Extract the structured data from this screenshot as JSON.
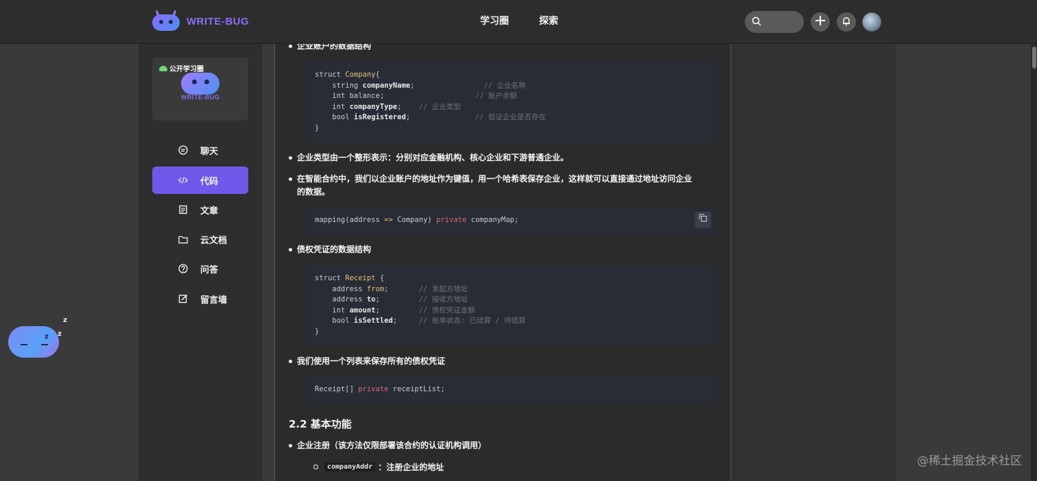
{
  "header": {
    "logo_text": "WRITE-BUG",
    "nav": [
      "学习圈",
      "探索"
    ],
    "search_placeholder": ""
  },
  "sidebar": {
    "circle_tag": "公开学习圈",
    "circle_brand": "WRITE-BUG",
    "items": [
      {
        "label": "聊天",
        "icon": "chat-icon"
      },
      {
        "label": "代码",
        "icon": "code-icon",
        "active": true
      },
      {
        "label": "文章",
        "icon": "article-icon"
      },
      {
        "label": "云文档",
        "icon": "folder-icon"
      },
      {
        "label": "问答",
        "icon": "question-icon"
      },
      {
        "label": "留言墙",
        "icon": "edit-icon"
      }
    ]
  },
  "content": {
    "b1": "企业账户的数据结构",
    "b2": "企业类型由一个整形表示：分别对应金融机构、核心企业和下游普通企业。",
    "b3_line1": "在智能合约中，我们以企业账户的地址作为键值，用一个哈希表保存企业，这样就可以直接通过地址访问企业",
    "b3_line2": "的数据。",
    "b4": "债权凭证的数据结构",
    "b5": "我们使用一个列表来保存所有的债权凭证",
    "h2": "2.2 基本功能",
    "b6": "企业注册（该方法仅限部署该合约的认证机构调用）",
    "sub1_code": "companyAddr",
    "sub1_text": "：注册企业的地址"
  },
  "code1": {
    "l1a": "struct ",
    "l1b": "Company",
    "l1c": "{",
    "l2a": "    string ",
    "l2b": "companyName",
    "l2c": ";                ",
    "l2d": "// 企业名称",
    "l3a": "    int balance;                     ",
    "l3d": "// 账户余额",
    "l4a": "    int ",
    "l4b": "companyType",
    "l4c": ";    ",
    "l4d": "// 企业类型",
    "l5a": "    bool ",
    "l5b": "isRegistered",
    "l5c": ";               ",
    "l5d": "// 验证企业是否存在",
    "l6": "}"
  },
  "code2": {
    "a": "mapping(address ",
    "op": "=>",
    "b": " Company) ",
    "pv": "private",
    "c": " companyMap;"
  },
  "code3": {
    "l1a": "struct ",
    "l1b": "Receipt",
    "l1c": " {",
    "l2a": "    address ",
    "l2b": "from",
    "l2c": ";       ",
    "l2d": "// 发起方地址",
    "l3a": "    address ",
    "l3b": "to",
    "l3c": ";         ",
    "l3d": "// 接收方地址",
    "l4a": "    int ",
    "l4b": "amount",
    "l4c": ";         ",
    "l4d": "// 债权凭证金额",
    "l5a": "    bool ",
    "l5b": "isSettled",
    "l5c": ";     ",
    "l5d": "// 账单状态: 已结算 / 待结算",
    "l6": "}"
  },
  "code4": {
    "a": "Receipt[] ",
    "pv": "private",
    "b": " receiptList;"
  },
  "floating": {
    "z1": "z",
    "z2": "z",
    "z3": "z"
  },
  "watermark": "@稀土掘金技术社区"
}
